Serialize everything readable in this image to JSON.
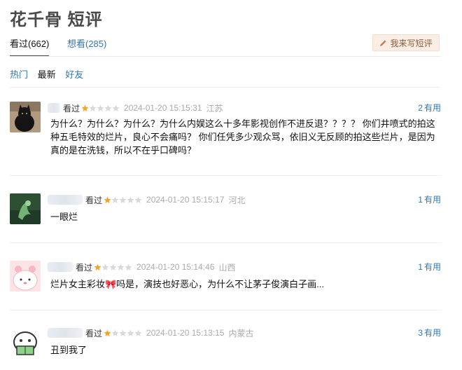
{
  "page": {
    "title": "花千骨 短评"
  },
  "tabs": [
    {
      "label": "看过(662)"
    },
    {
      "label": "想看(285)"
    }
  ],
  "write_button": {
    "label": "我来写短评",
    "icon": "pencil-icon"
  },
  "sort": [
    {
      "label": "热门"
    },
    {
      "label": "最新"
    },
    {
      "label": "好友"
    }
  ],
  "comments": [
    {
      "status": "看过",
      "rating": 1,
      "time": "2024-01-20 15:15:31",
      "location": "江苏",
      "votes": "2",
      "votes_label": "有用",
      "text": "为什么？为什么？为什么？为什么内娱这么十多年影视创作不进反退？？？？ 你们井喷式的拍这种五毛特效的烂片，良心不会痛吗？ 你们任凭多少观众骂，依旧义无反顾的拍这些烂片，是因为真的是在洗钱，所以不在乎口碑吗？"
    },
    {
      "status": "看过",
      "rating": 1,
      "time": "2024-01-20 15:15:17",
      "location": "河北",
      "votes": "1",
      "votes_label": "有用",
      "text": "一眼烂"
    },
    {
      "status": "看过",
      "rating": 1,
      "time": "2024-01-20 15:14:46",
      "location": "山西",
      "votes": "1",
      "votes_label": "有用",
      "text": "烂片女主彩妆🎀吗是，演技也好恶心，为什么不让茅子俊演白子画..."
    },
    {
      "status": "看过",
      "rating": 1,
      "time": "2024-01-20 15:13:15",
      "location": "内蒙古",
      "votes": "3",
      "votes_label": "有用",
      "text": "丑到我了"
    }
  ],
  "colors": {
    "link": "#3377aa",
    "star": "#f5a623",
    "star_empty": "#d9d9d9",
    "muted": "#aaaaaa"
  }
}
